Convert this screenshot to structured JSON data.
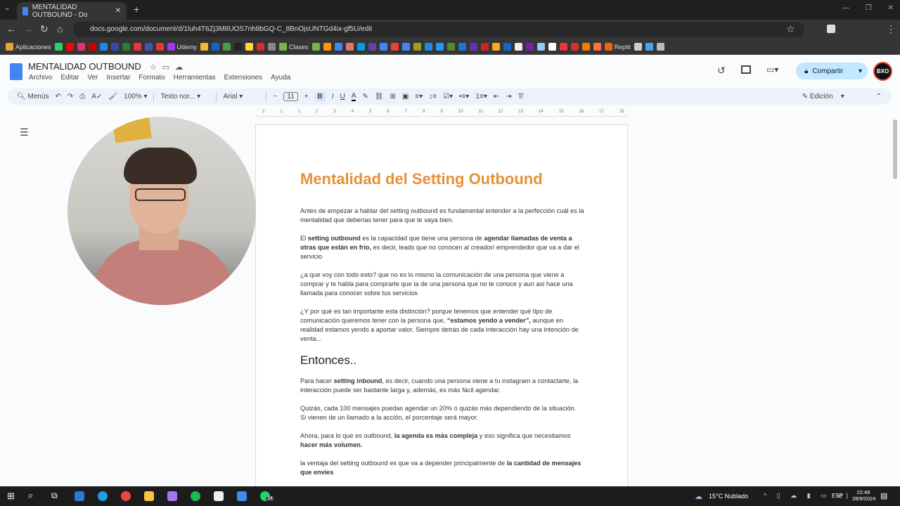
{
  "browser": {
    "tab_title": "MENTALIDAD OUTBOUND - Do",
    "url": "docs.google.com/document/d/1luh4T6Zj3M8UOS7nh8bGQ-C_8BnOjsUNTGd4ix-gf5U/edit",
    "bookmarks": [
      {
        "label": "Aplicaciones",
        "color": "#e8a33d"
      },
      {
        "label": "",
        "color": "#25d366"
      },
      {
        "label": "",
        "color": "#ff0000"
      },
      {
        "label": "",
        "color": "#e1306c"
      },
      {
        "label": "",
        "color": "#c00"
      },
      {
        "label": "",
        "color": "#1e88e5"
      },
      {
        "label": "",
        "color": "#3949ab"
      },
      {
        "label": "",
        "color": "#2e7d32"
      },
      {
        "label": "",
        "color": "#e53935"
      },
      {
        "label": "",
        "color": "#3f51b5"
      },
      {
        "label": "",
        "color": "#e53935"
      },
      {
        "label": "Udemy",
        "color": "#a435f0"
      },
      {
        "label": "",
        "color": "#f3ba2f"
      },
      {
        "label": "",
        "color": "#1565c0"
      },
      {
        "label": "",
        "color": "#43a047"
      },
      {
        "label": "",
        "color": "#222"
      },
      {
        "label": "",
        "color": "#fdd835"
      },
      {
        "label": "",
        "color": "#d32f2f"
      },
      {
        "label": "",
        "color": "#888"
      },
      {
        "label": "Clases",
        "color": "#7cb342"
      },
      {
        "label": "",
        "color": "#7cb342"
      },
      {
        "label": "",
        "color": "#ff9800"
      },
      {
        "label": "",
        "color": "#4285f4"
      },
      {
        "label": "",
        "color": "#e57373"
      },
      {
        "label": "",
        "color": "#039be5"
      },
      {
        "label": "",
        "color": "#6441a5"
      },
      {
        "label": "",
        "color": "#4285f4"
      },
      {
        "label": "",
        "color": "#ea4335"
      },
      {
        "label": "",
        "color": "#4285f4"
      },
      {
        "label": "",
        "color": "#9e9d24"
      },
      {
        "label": "",
        "color": "#1e88e5"
      },
      {
        "label": "",
        "color": "#2196f3"
      },
      {
        "label": "",
        "color": "#558b2f"
      },
      {
        "label": "",
        "color": "#1976d2"
      },
      {
        "label": "",
        "color": "#5e35b1"
      },
      {
        "label": "",
        "color": "#c62828"
      },
      {
        "label": "",
        "color": "#f9a825"
      },
      {
        "label": "",
        "color": "#1565c0"
      },
      {
        "label": "",
        "color": "#eee"
      },
      {
        "label": "",
        "color": "#7b1fa2"
      },
      {
        "label": "",
        "color": "#90caf9"
      },
      {
        "label": "",
        "color": "#fff"
      },
      {
        "label": "",
        "color": "#e53935"
      },
      {
        "label": "",
        "color": "#d32f2f"
      },
      {
        "label": "",
        "color": "#f57c00"
      },
      {
        "label": "",
        "color": "#ff7043"
      },
      {
        "label": "Replit",
        "color": "#f26207"
      },
      {
        "label": "",
        "color": "#ccc"
      },
      {
        "label": "",
        "color": "#42a5f5"
      },
      {
        "label": "",
        "color": "#bbb"
      }
    ]
  },
  "docs": {
    "title": "MENTALIDAD OUTBOUND",
    "menus": [
      "Archivo",
      "Editar",
      "Ver",
      "Insertar",
      "Formato",
      "Herramientas",
      "Extensiones",
      "Ayuda"
    ],
    "share_label": "Compartir",
    "avatar": "BXO",
    "toolbar": {
      "search": "Menús",
      "zoom": "100%",
      "style": "Texto nor...",
      "font": "Arial",
      "size": "11",
      "mode": "Edición"
    },
    "ruler": [
      "2",
      "1",
      "1",
      "2",
      "3",
      "4",
      "5",
      "6",
      "7",
      "8",
      "9",
      "10",
      "11",
      "12",
      "13",
      "14",
      "15",
      "16",
      "17",
      "18"
    ]
  },
  "document": {
    "heading": "Mentalidad del Setting Outbound",
    "p1": "Antes de empezar a hablar del setting outbound es fundamental entender a la perfección cuál es la mentalidad que deberías tener para que te vaya bien.",
    "p2": {
      "a": "El ",
      "b": "setting outbound",
      "c": " es la capacidad que tiene una persona de ",
      "d": "agendar llamadas de venta a otras que están en frío,",
      "e": " es decir, leads que no conocen al creador/ emprendedor que va a dar el servicio"
    },
    "p3": "¿a que voy con todo esto? que no es lo mismo la comunicación de una persona que viene a comprar y te habla para comprarte que la de una persona que no te conoce y aun asi hace una llamada para conocer sobre tus servicios",
    "p4": {
      "a": "¿Y por qué es tan importante esta distinción? porque tenemos que entender qué tipo de comunicación queremos tener con la persona que, ",
      "b": "“estamos yendo a vender”,",
      "c": " aunque en realidad estamos yendo a aportar valor. Siempre detrás de cada interacción hay una intención de venta..."
    },
    "subheading": "Entonces..",
    "p5": {
      "a": "Para hacer ",
      "b": "setting inbound",
      "c": ", es decir, cuando una persona viene a tu instagram a contactarte, la interacción puede ser bastante larga y, además, es más fácil agendar."
    },
    "p6a": "Quizás, cada 100 mensajes puedas agendar un 20% o quizás más dependiendo de la situación.",
    "p6b": "Si vienen de un llamado a la acción, el porcentaje será mayor.",
    "p7": {
      "a": "Ahora, para lo que es outbound, ",
      "b": "la agenda es más compleja",
      "c": " y eso significa que necesitamos ",
      "d": "hacer más volumen."
    },
    "p8": {
      "a": "la ventaja del setting outbound es que va a depender principalmente de ",
      "b": "la cantidad de mensajes que envies"
    }
  },
  "taskbar": {
    "weather": "15°C  Nublado",
    "lang": "ESP",
    "time": "22:48",
    "date": "28/9/2024",
    "badge": "34"
  }
}
